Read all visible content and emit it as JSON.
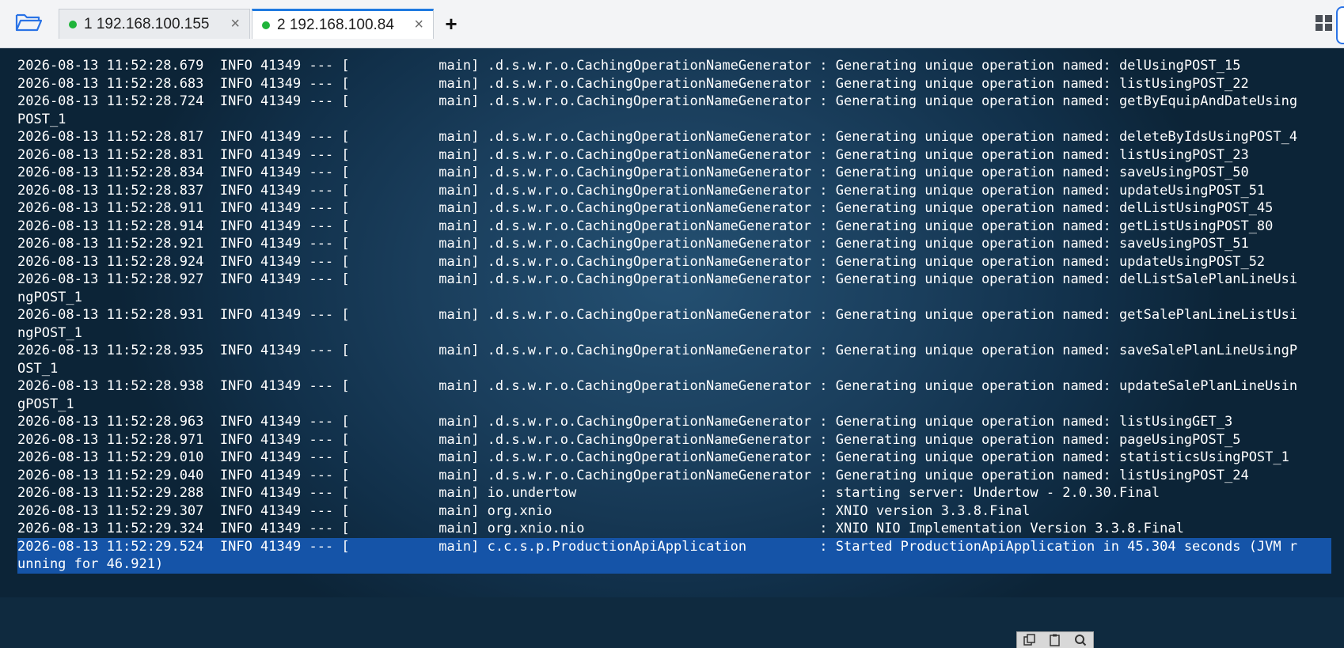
{
  "tabbar": {
    "folder_icon": "folder-open-icon",
    "tabs": [
      {
        "label": "1 192.168.100.155",
        "status_color": "#1fb43a",
        "active": false
      },
      {
        "label": "2 192.168.100.84",
        "status_color": "#1fb43a",
        "active": true
      }
    ],
    "close_glyph": "×",
    "add_glyph": "+",
    "layout_icon": "grid-icon"
  },
  "terminal": {
    "accent_selection": "#1554a8",
    "lines": [
      "2026-08-13 11:52:28.679  INFO 41349 --- [           main] .d.s.w.r.o.CachingOperationNameGenerator : Generating unique operation named: delUsingPOST_15",
      "2026-08-13 11:52:28.683  INFO 41349 --- [           main] .d.s.w.r.o.CachingOperationNameGenerator : Generating unique operation named: listUsingPOST_22",
      "2026-08-13 11:52:28.724  INFO 41349 --- [           main] .d.s.w.r.o.CachingOperationNameGenerator : Generating unique operation named: getByEquipAndDateUsing",
      "POST_1",
      "2026-08-13 11:52:28.817  INFO 41349 --- [           main] .d.s.w.r.o.CachingOperationNameGenerator : Generating unique operation named: deleteByIdsUsingPOST_4",
      "2026-08-13 11:52:28.831  INFO 41349 --- [           main] .d.s.w.r.o.CachingOperationNameGenerator : Generating unique operation named: listUsingPOST_23",
      "2026-08-13 11:52:28.834  INFO 41349 --- [           main] .d.s.w.r.o.CachingOperationNameGenerator : Generating unique operation named: saveUsingPOST_50",
      "2026-08-13 11:52:28.837  INFO 41349 --- [           main] .d.s.w.r.o.CachingOperationNameGenerator : Generating unique operation named: updateUsingPOST_51",
      "2026-08-13 11:52:28.911  INFO 41349 --- [           main] .d.s.w.r.o.CachingOperationNameGenerator : Generating unique operation named: delListUsingPOST_45",
      "2026-08-13 11:52:28.914  INFO 41349 --- [           main] .d.s.w.r.o.CachingOperationNameGenerator : Generating unique operation named: getListUsingPOST_80",
      "2026-08-13 11:52:28.921  INFO 41349 --- [           main] .d.s.w.r.o.CachingOperationNameGenerator : Generating unique operation named: saveUsingPOST_51",
      "2026-08-13 11:52:28.924  INFO 41349 --- [           main] .d.s.w.r.o.CachingOperationNameGenerator : Generating unique operation named: updateUsingPOST_52",
      "2026-08-13 11:52:28.927  INFO 41349 --- [           main] .d.s.w.r.o.CachingOperationNameGenerator : Generating unique operation named: delListSalePlanLineUsi",
      "ngPOST_1",
      "2026-08-13 11:52:28.931  INFO 41349 --- [           main] .d.s.w.r.o.CachingOperationNameGenerator : Generating unique operation named: getSalePlanLineListUsi",
      "ngPOST_1",
      "2026-08-13 11:52:28.935  INFO 41349 --- [           main] .d.s.w.r.o.CachingOperationNameGenerator : Generating unique operation named: saveSalePlanLineUsingP",
      "OST_1",
      "2026-08-13 11:52:28.938  INFO 41349 --- [           main] .d.s.w.r.o.CachingOperationNameGenerator : Generating unique operation named: updateSalePlanLineUsin",
      "gPOST_1",
      "2026-08-13 11:52:28.963  INFO 41349 --- [           main] .d.s.w.r.o.CachingOperationNameGenerator : Generating unique operation named: listUsingGET_3",
      "2026-08-13 11:52:28.971  INFO 41349 --- [           main] .d.s.w.r.o.CachingOperationNameGenerator : Generating unique operation named: pageUsingPOST_5",
      "2026-08-13 11:52:29.010  INFO 41349 --- [           main] .d.s.w.r.o.CachingOperationNameGenerator : Generating unique operation named: statisticsUsingPOST_1",
      "2026-08-13 11:52:29.040  INFO 41349 --- [           main] .d.s.w.r.o.CachingOperationNameGenerator : Generating unique operation named: listUsingPOST_24",
      "2026-08-13 11:52:29.288  INFO 41349 --- [           main] io.undertow                              : starting server: Undertow - 2.0.30.Final",
      "2026-08-13 11:52:29.307  INFO 41349 --- [           main] org.xnio                                 : XNIO version 3.3.8.Final",
      "2026-08-13 11:52:29.324  INFO 41349 --- [           main] org.xnio.nio                             : XNIO NIO Implementation Version 3.3.8.Final",
      "2026-08-13 11:52:29.524  INFO 41349 --- [           main] c.c.s.p.ProductionApiApplication         : Started ProductionApiApplication in 45.304 seconds (JVM r",
      "unning for 46.921)"
    ]
  },
  "bottom_toolbar": {
    "icons": [
      "copy-icon",
      "paste-icon",
      "search-icon"
    ]
  }
}
